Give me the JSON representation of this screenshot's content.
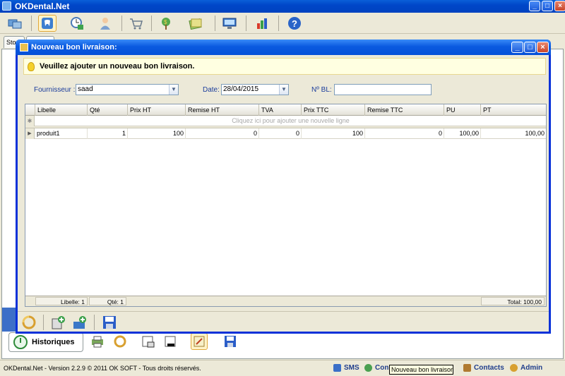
{
  "app": {
    "title": "OKDental.Net"
  },
  "toolbar": {
    "icons": [
      "cards-icon",
      "tooth-icon",
      "clock-calendar-icon",
      "patient-icon",
      "cart-icon",
      "money-tree-icon",
      "notes-icon",
      "monitor-icon",
      "chart-icon",
      "help-icon"
    ]
  },
  "background": {
    "tab_left": "Sto",
    "historiques_label": "Historiques"
  },
  "dialog": {
    "title": "Nouveau bon livraison:",
    "banner": "Veuillez ajouter un nouveau bon livraison.",
    "fournisseur_label": "Fournisseur :",
    "fournisseur_value": "saad",
    "date_label": "Date:",
    "date_value": "28/04/2015",
    "nbl_label": "Nº BL:",
    "nbl_value": ""
  },
  "grid": {
    "columns": [
      "Libelle",
      "Qté",
      "Prix HT",
      "Remise HT",
      "TVA",
      "Prix TTC",
      "Remise TTC",
      "PU",
      "PT"
    ],
    "new_row_hint": "Cliquez ici pour ajouter une nouvelle ligne",
    "rows": [
      [
        "produit1",
        "1",
        "100",
        "0",
        "0",
        "100",
        "0",
        "100,00",
        "100,00"
      ]
    ],
    "footer": {
      "libelle_count": "Libelle: 1",
      "qte_count": "Qté: 1",
      "total": "Total: 100,00"
    }
  },
  "status": {
    "version": "OKDental.Net - Version 2.2.9 © 2011 OK SOFT - Tous droits réservés.",
    "sms": "SMS",
    "connexion": "Con",
    "contacts": "Contacts",
    "admin": "Admin",
    "tooltip": "Nouveau bon livraison:"
  }
}
